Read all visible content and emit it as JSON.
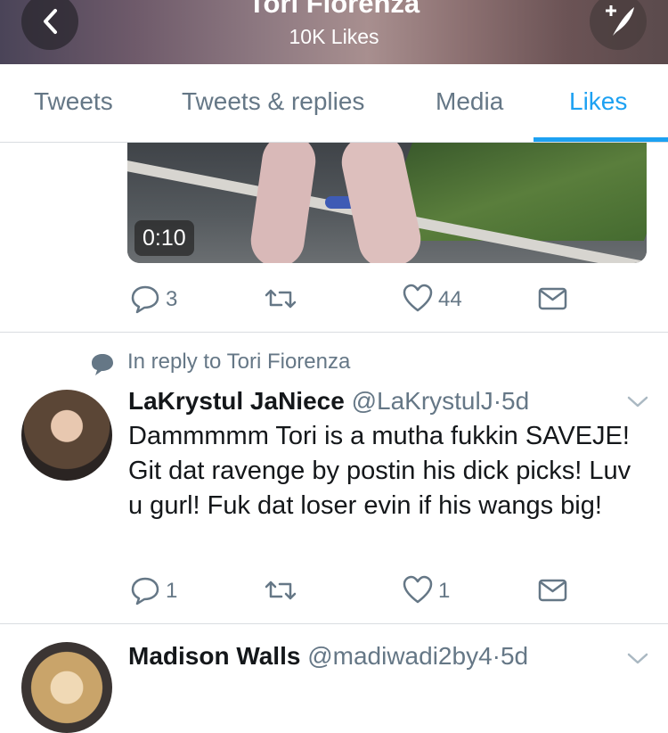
{
  "header": {
    "title": "Tori Fiorenza",
    "subtitle": "10K Likes"
  },
  "tabs": [
    {
      "label": "Tweets",
      "active": false
    },
    {
      "label": "Tweets & replies",
      "active": false
    },
    {
      "label": "Media",
      "active": false
    },
    {
      "label": "Likes",
      "active": true
    }
  ],
  "tweet1": {
    "video_duration": "0:10",
    "replies": "3",
    "retweets": "",
    "likes": "44"
  },
  "tweet2": {
    "reply_context": "In reply to Tori Fiorenza",
    "name": "LaKrystul JaNiece",
    "handle": "@LaKrystulJ",
    "separator": "·",
    "time": "5d",
    "text": "Dammmmm Tori is a mutha fukkin SAVEJE! Git dat ravenge by postin his dick picks! Luv u gurl! Fuk dat loser evin if his wangs big!",
    "replies": "1",
    "likes": "1"
  },
  "tweet3": {
    "name": "Madison Walls",
    "handle": "@madiwadi2by4",
    "separator": "·",
    "time": "5d"
  },
  "colors": {
    "accent": "#1da1f2",
    "muted": "#657786",
    "text": "#14171a"
  },
  "icons": [
    "back-arrow-icon",
    "compose-feather-icon",
    "reply-icon",
    "retweet-icon",
    "heart-icon",
    "share-mail-icon",
    "speech-bubble-icon",
    "chevron-down-icon"
  ]
}
